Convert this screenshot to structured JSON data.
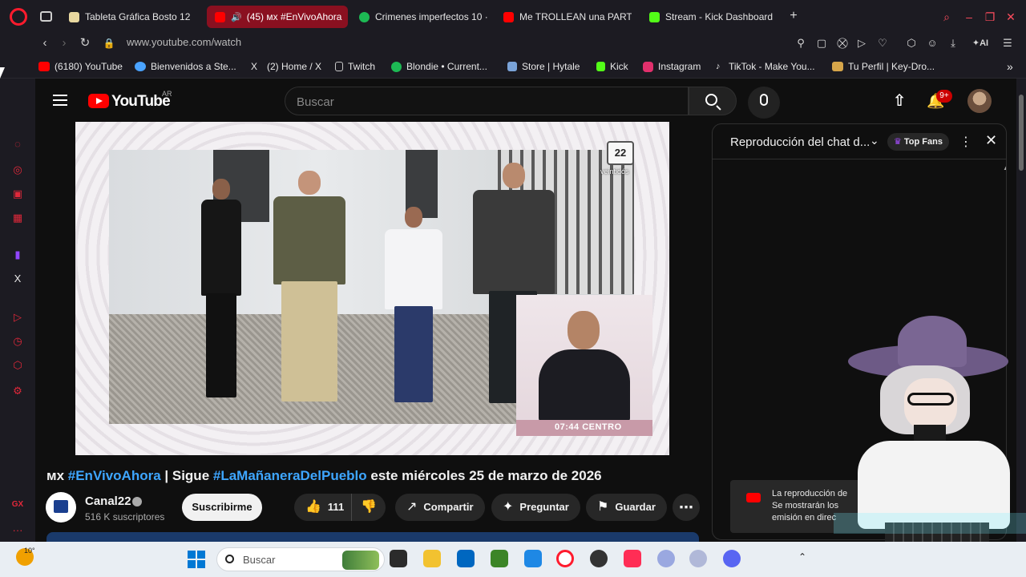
{
  "browser": {
    "tabs": [
      {
        "label": "Tableta Gráfica Bosto 12",
        "active": false,
        "color": "#e8d8a0"
      },
      {
        "label": "(45) ᴍx #EnVivoAhora",
        "active": true,
        "color": "#ff0000"
      },
      {
        "label": "Crimenes imperfectos 10 ·",
        "active": false,
        "color": "#1db954"
      },
      {
        "label": "Me TROLLEAN una PARTI",
        "active": false,
        "color": "#ff0000"
      },
      {
        "label": "Stream - Kick Dashboard",
        "active": false,
        "color": "#53fc18"
      }
    ],
    "url": "www.youtube.com/watch",
    "ai_label": "AI",
    "bookmarks": [
      {
        "label": "(6180) YouTube",
        "color": "#ff0000"
      },
      {
        "label": "Bienvenidos a Ste...",
        "color": "#4aa3ff"
      },
      {
        "label": "(2) Home / X",
        "color": "#e8e8e8"
      },
      {
        "label": "Twitch",
        "color": "#c8c8c8"
      },
      {
        "label": "Blondie • Current...",
        "color": "#1db954"
      },
      {
        "label": "Store | Hytale",
        "color": "#7aa3d8"
      },
      {
        "label": "Kick",
        "color": "#53fc18"
      },
      {
        "label": "Instagram",
        "color": "#e1306c"
      },
      {
        "label": "TikTok - Make You...",
        "color": "#e8e8e8"
      },
      {
        "label": "Tu Perfil | Key-Dro...",
        "color": "#d6a54a"
      }
    ]
  },
  "youtube": {
    "logo_text": "YouTube",
    "country": "AR",
    "search_placeholder": "Buscar",
    "notifications": "9+",
    "video": {
      "channel_bug": "22",
      "channel_bug_sub": "veintidós",
      "timestamp": "07:44  CENTRO",
      "title_prefix": "ᴍx",
      "title_hash1": "#EnVivoAhora",
      "title_mid": " | Sigue ",
      "title_hash2": "#LaMañaneraDelPueblo",
      "title_suffix": " este miércoles 25 de marzo de 2026"
    },
    "channel": {
      "name": "Canal22",
      "subscribers": "516 K suscriptores",
      "subscribe_label": "Suscribirme"
    },
    "actions": {
      "likes": "111",
      "share": "Compartir",
      "ask": "Preguntar",
      "save": "Guardar"
    },
    "chat": {
      "title": "Reproducción del chat d...",
      "top_fans": "Top Fans",
      "notice_line1": "La reproducción de",
      "notice_line2": "Se mostrarán los",
      "notice_line3": "emisión en direc"
    }
  },
  "taskbar": {
    "temperature": "10°",
    "search_label": "Buscar"
  }
}
